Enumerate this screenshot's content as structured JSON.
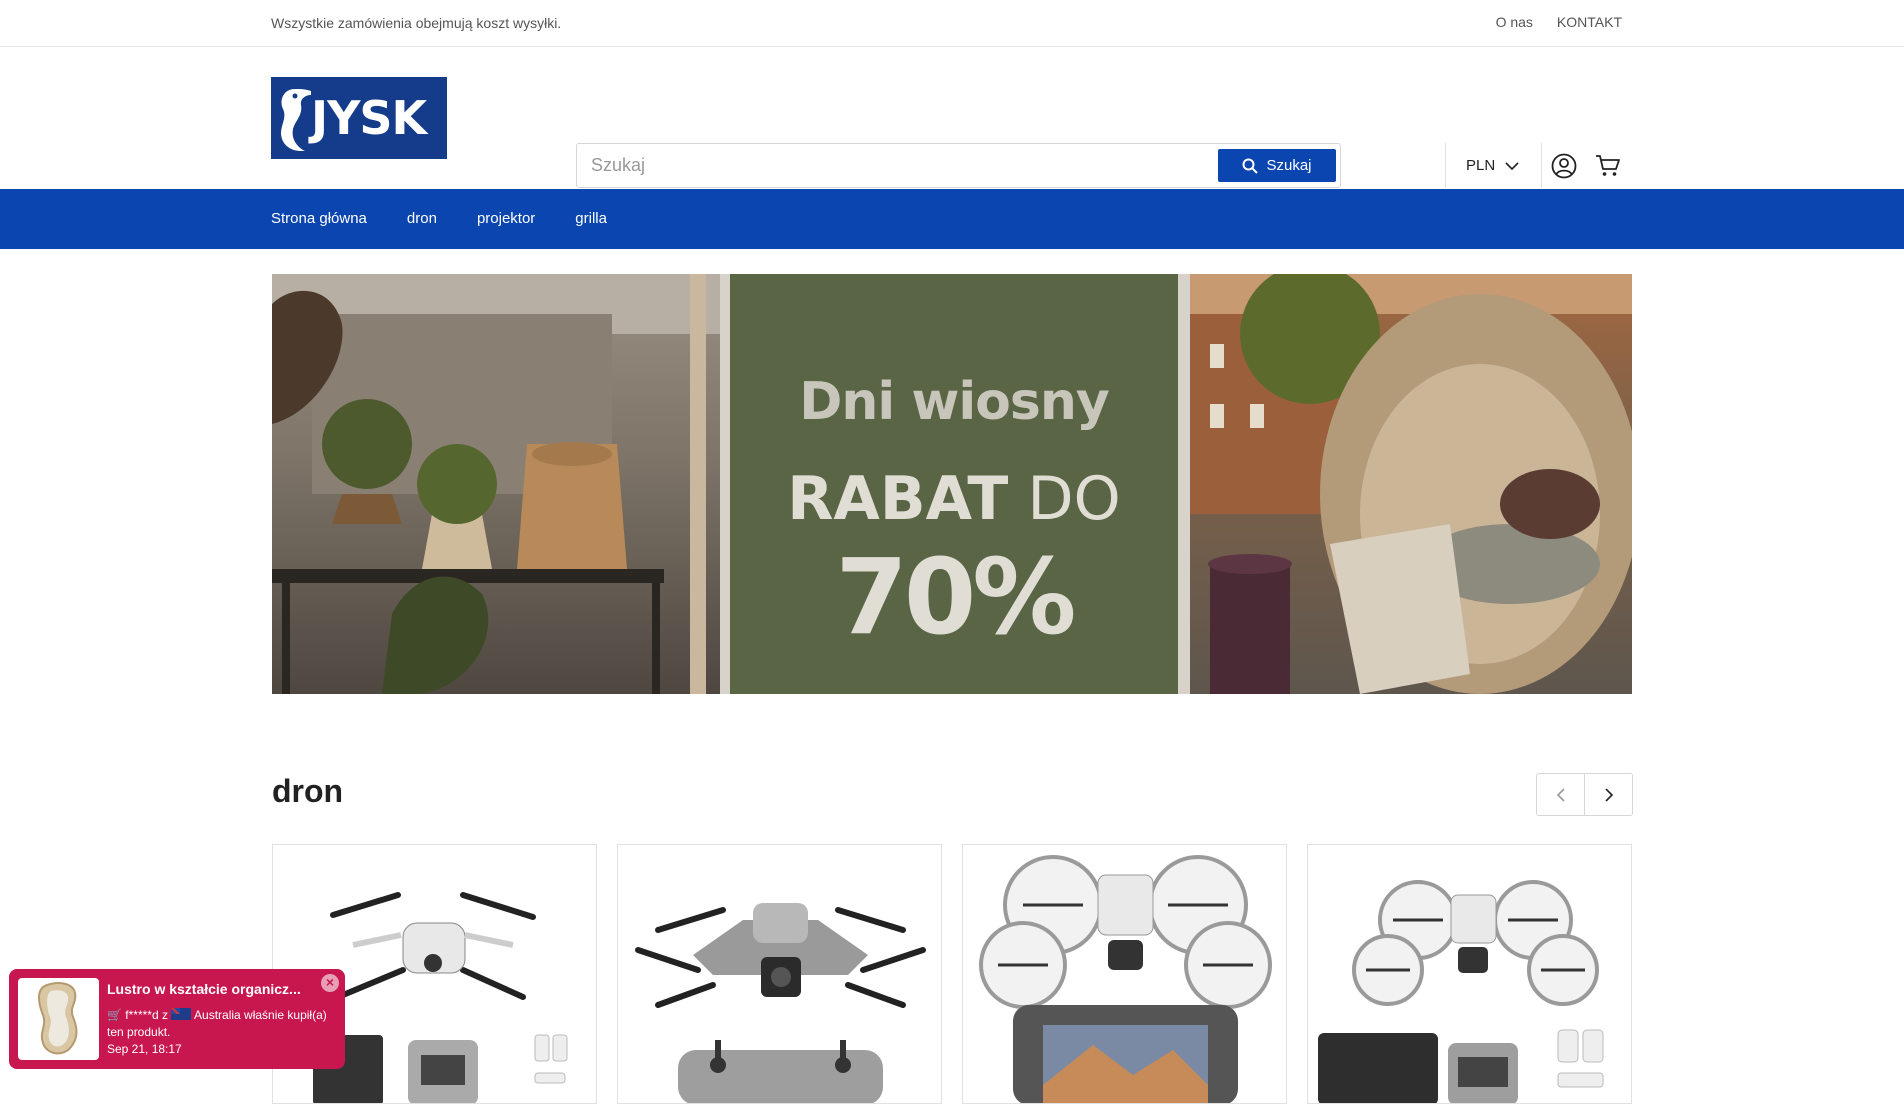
{
  "topbar": {
    "note": "Wszystkie zamówienia obejmują koszt wysyłki.",
    "links": [
      "O nas",
      "KONTAKT"
    ]
  },
  "header": {
    "logo_text": "JYSK",
    "search": {
      "placeholder": "Szukaj",
      "value": "",
      "button_label": "Szukaj"
    },
    "currency": "PLN"
  },
  "nav": {
    "items": [
      "Strona główna",
      "dron",
      "projektor",
      "grilla"
    ]
  },
  "banner": {
    "title": "Dni wiosny",
    "rabat_bold": "RABAT",
    "rabat_rest": "DO",
    "percent": "70%",
    "colors": {
      "middle": "#596545",
      "text": "#e0ddd4"
    }
  },
  "section": {
    "title": "dron",
    "products": [
      {
        "icon": "drone-mini-product-image"
      },
      {
        "icon": "drone-air-product-image"
      },
      {
        "icon": "drone-flip-product-image"
      },
      {
        "icon": "drone-flip-combo-product-image"
      }
    ]
  },
  "toast": {
    "title": "Lustro w kształcie organicz...",
    "line_prefix": "f*****d z",
    "line_suffix": "Australia właśnie kupił(a) ten produkt.",
    "time": "Sep 21, 18:17",
    "close": "×"
  },
  "colors": {
    "brand_blue": "#0a45b0",
    "logo_blue": "#143c8a",
    "toast": "#c8164f"
  }
}
